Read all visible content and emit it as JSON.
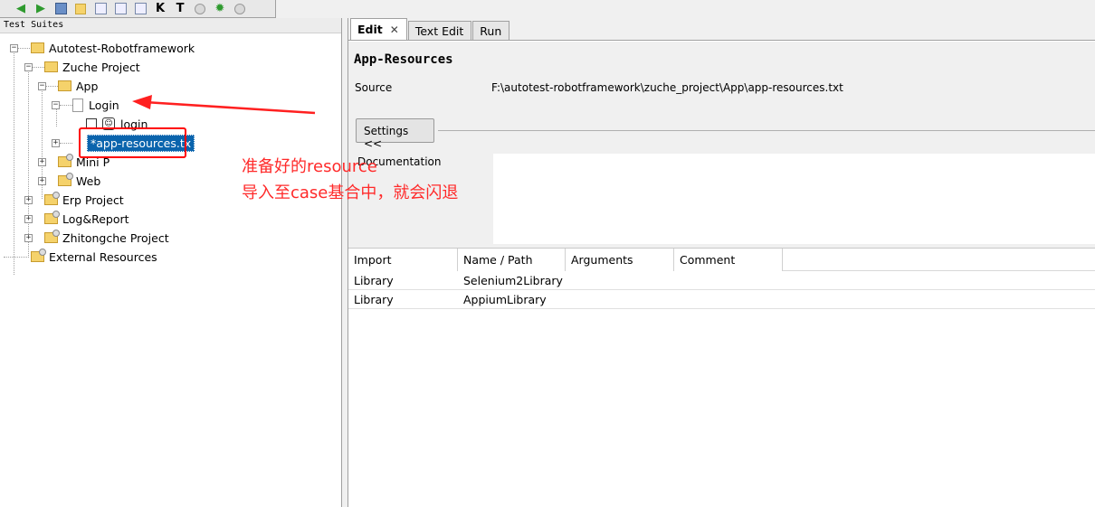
{
  "toolbar": {
    "buttons": [
      "back-arrow-icon",
      "forward-arrow-icon",
      "save-icon",
      "open-folder-icon",
      "download-icon",
      "download-all-icon",
      "export-icon",
      "k-icon",
      "t-icon",
      "run-icon",
      "bug-icon",
      "stop-icon"
    ],
    "k_label": "K",
    "t_label": "T"
  },
  "left_panel": {
    "title": "Test Suites",
    "tree": {
      "root": "Autotest-Robotframework",
      "zuche": "Zuche Project",
      "app": "App",
      "login_suite": "Login",
      "login_case": "login",
      "app_resources": "*app-resources.tx",
      "mini_p": "Mini P",
      "web": "Web",
      "erp": "Erp Project",
      "log_report": "Log&Report",
      "zhitongche": "Zhitongche Project",
      "external": "External Resources"
    }
  },
  "annotation": {
    "line1": "准备好的resource",
    "line2": "导入至case基合中，就会闪退",
    "color": "#ff0000"
  },
  "tabs": [
    {
      "label": "Edit",
      "active": true
    },
    {
      "label": "Text Edit",
      "active": false
    },
    {
      "label": "Run",
      "active": false
    }
  ],
  "edit": {
    "title": "App-Resources",
    "source_label": "Source",
    "source_value": "F:\\autotest-robotframework\\zuche_project\\App\\app-resources.txt",
    "settings_button": "Settings <<",
    "documentation_label": "Documentation",
    "table": {
      "headers": [
        "Import",
        "Name / Path",
        "Arguments",
        "Comment"
      ],
      "rows": [
        [
          "Library",
          "Selenium2Library",
          "",
          ""
        ],
        [
          "Library",
          "AppiumLibrary",
          "",
          ""
        ]
      ]
    }
  }
}
